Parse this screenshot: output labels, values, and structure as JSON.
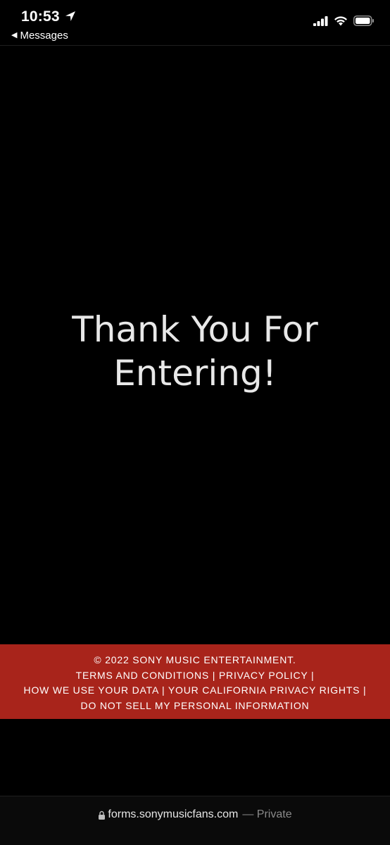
{
  "status_bar": {
    "time": "10:53",
    "back_label": "Messages",
    "icons": [
      "location-arrow-icon",
      "cellular-signal-icon",
      "wifi-icon",
      "battery-icon"
    ]
  },
  "main": {
    "heading_line1": "Thank You For",
    "heading_line2": "Entering!"
  },
  "footer": {
    "copyright": "© 2022 SONY MUSIC ENTERTAINMENT.",
    "terms": "TERMS AND CONDITIONS",
    "privacy": "PRIVACY POLICY",
    "data_use": "HOW WE USE YOUR DATA",
    "ca_rights": "YOUR CALIFORNIA PRIVACY RIGHTS",
    "do_not_sell": "DO NOT SELL MY PERSONAL INFORMATION",
    "separator": " | ",
    "background_color": "#a8241b"
  },
  "browser": {
    "url": "forms.sonymusicfans.com",
    "separator": "—",
    "mode": "Private"
  }
}
